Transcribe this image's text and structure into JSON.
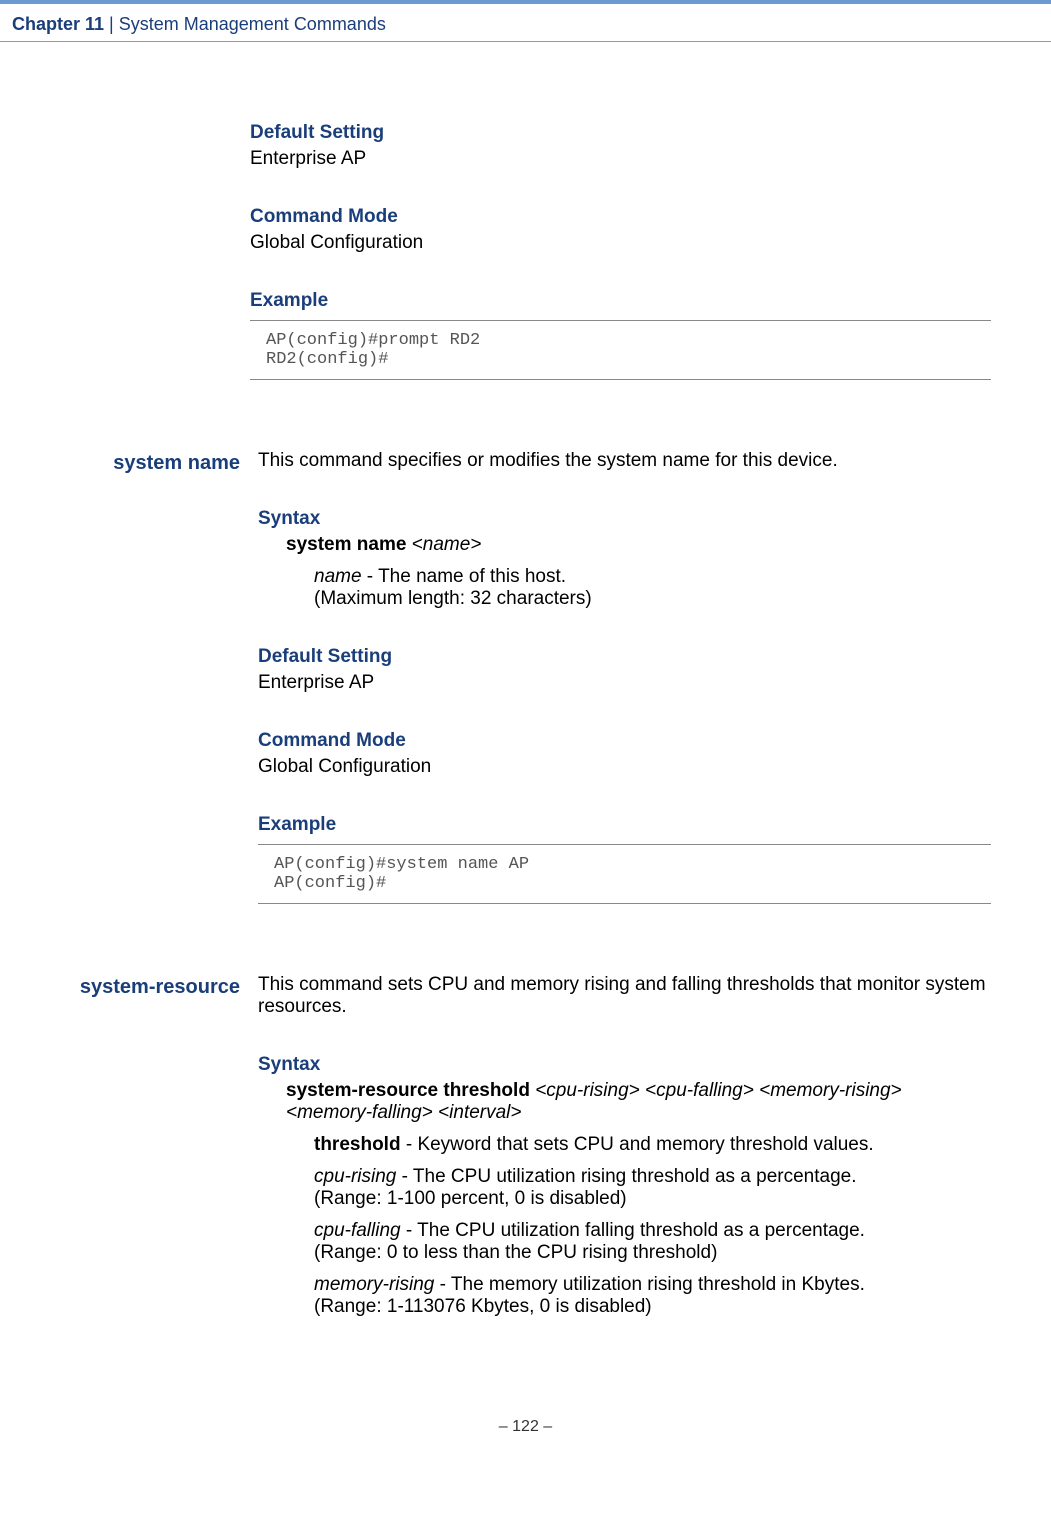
{
  "header": {
    "chapter_num": "Chapter 11",
    "separator": " | ",
    "chapter_title": "System Management Commands"
  },
  "sections": [
    {
      "default_setting_heading": "Default Setting",
      "default_setting_value": "Enterprise AP",
      "command_mode_heading": "Command Mode",
      "command_mode_value": "Global Configuration",
      "example_heading": "Example",
      "example_code": "AP(config)#prompt RD2\nRD2(config)#"
    }
  ],
  "commands": [
    {
      "label": "system name",
      "description": "This command specifies or modifies the system name for this device.",
      "syntax_heading": "Syntax",
      "syntax_cmd_bold": "system name",
      "syntax_cmd_arg": " <name>",
      "params": [
        {
          "name_italic": "name",
          "desc": " - The name of this host.",
          "range": "(Maximum length: 32 characters)"
        }
      ],
      "default_setting_heading": "Default Setting",
      "default_setting_value": "Enterprise AP",
      "command_mode_heading": "Command Mode",
      "command_mode_value": "Global Configuration",
      "example_heading": "Example",
      "example_code": "AP(config)#system name AP\nAP(config)#"
    },
    {
      "label": "system-resource",
      "description": "This command sets CPU and memory rising and falling thresholds that monitor system resources.",
      "syntax_heading": "Syntax",
      "syntax_cmd_bold": "system-resource threshold",
      "syntax_cmd_arg": " <cpu-rising> <cpu-falling> <memory-rising> <memory-falling> <interval>",
      "params": [
        {
          "name_bold": "threshold",
          "desc": " - Keyword that sets CPU and memory threshold values."
        },
        {
          "name_italic": "cpu-rising",
          "desc": " - The CPU utilization rising threshold as a percentage.",
          "range": "(Range: 1-100 percent, 0 is disabled)"
        },
        {
          "name_italic": "cpu-falling",
          "desc": " - The CPU utilization falling threshold as a percentage.",
          "range": "(Range: 0 to less than the CPU rising threshold)"
        },
        {
          "name_italic": "memory-rising",
          "desc": " - The memory utilization rising threshold in Kbytes.",
          "range": "(Range: 1-113076 Kbytes, 0 is disabled)"
        }
      ]
    }
  ],
  "footer": {
    "page_number": "–  122  –"
  }
}
